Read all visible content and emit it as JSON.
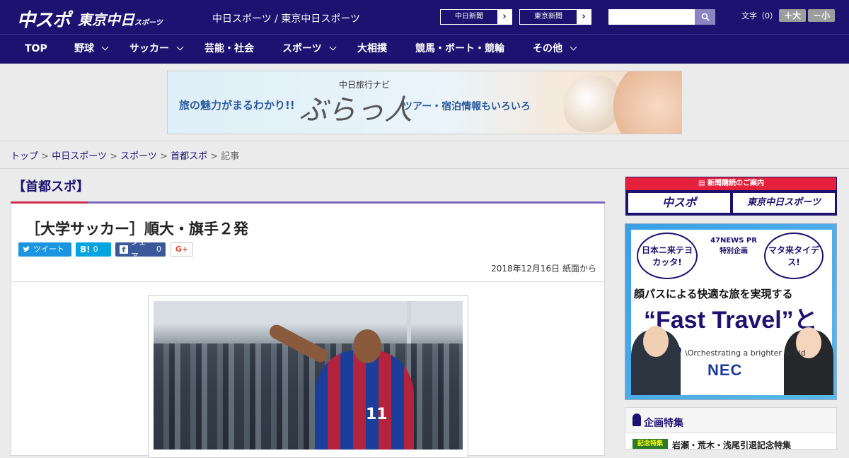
{
  "header": {
    "logo_main": "中スポ",
    "logo_sub": "東京中日",
    "logo_sub_small": "スポーツ",
    "tagline": "中日スポーツ / 東京中日スポーツ",
    "paper_links": [
      {
        "label": "中日新聞"
      },
      {
        "label": "東京新聞"
      }
    ],
    "search_placeholder": "",
    "font_label": "文字（0）",
    "font_larger": "＋大",
    "font_smaller": "－小"
  },
  "nav": {
    "items": [
      {
        "label": "TOP"
      },
      {
        "label": "野球"
      },
      {
        "label": "サッカー"
      },
      {
        "label": "芸能・社会"
      },
      {
        "label": "スポーツ"
      },
      {
        "label": "大相撲"
      },
      {
        "label": "競馬・ボート・競輪"
      },
      {
        "label": "その他"
      }
    ]
  },
  "banner": {
    "left_text": "旅の魅力がまるわかり!!",
    "brand_small": "中日旅行ナビ",
    "brand_big": "ぶらっ人",
    "right_text": "ツアー・宿泊情報もいろいろ"
  },
  "breadcrumb": {
    "items": [
      "トップ",
      "中日スポーツ",
      "スポーツ",
      "首都スポ"
    ],
    "current": "記事",
    "separator": ">"
  },
  "article": {
    "section": "【首都スポ】",
    "headline": "［大学サッカー］順大・旗手２発",
    "share": {
      "tweet": "ツイート",
      "hatena": "B!",
      "hatena_count": "0",
      "facebook": "シェア",
      "facebook_count": "0",
      "gplus": "G+"
    },
    "date": "2018年12月16日 紙面から",
    "photo_jersey_number": "11"
  },
  "sidebar": {
    "subscribe_head": "新聞購読のご案内",
    "subscribe_logos": [
      "中スポ",
      "東京中日スポーツ"
    ],
    "ad": {
      "bubble_left": "日本ニ来テヨカッタ!",
      "pr": "47NEWS PR特別企画",
      "bubble_right": "マタ来タイデス!",
      "line1": "顔パスによる快適な旅を実現する",
      "line2": "“Fast Travel”とは?",
      "line3": "\\Orchestrating a brighter world",
      "brand": "NEC"
    },
    "feature_title": "企画特集",
    "feature_item": "岩瀬・荒木・浅尾引退記念特集",
    "feature_thumb": "記念特集"
  },
  "colors": {
    "brand_navy": "#1d1270",
    "accent_red": "#e5213d",
    "twitter": "#1b95e0",
    "hatena": "#00a4de",
    "facebook": "#3b5998"
  }
}
